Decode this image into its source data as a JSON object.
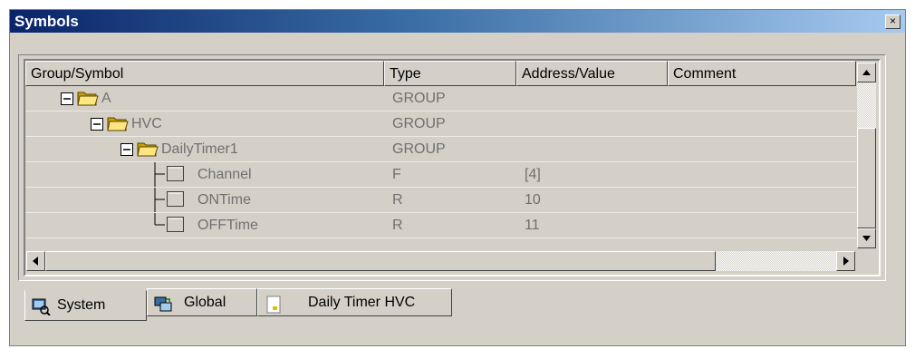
{
  "window": {
    "title": "Symbols",
    "close_glyph": "×"
  },
  "columns": [
    "Group/Symbol",
    "Type",
    "Address/Value",
    "Comment"
  ],
  "rows": [
    {
      "name": "A",
      "type": "GROUP",
      "value": "",
      "comment": "",
      "icon": "folder-open-icon",
      "expander": "minus"
    },
    {
      "name": "HVC",
      "type": "GROUP",
      "value": "",
      "comment": "",
      "icon": "folder-open-icon",
      "expander": "minus"
    },
    {
      "name": "DailyTimer1",
      "type": "GROUP",
      "value": "",
      "comment": "",
      "icon": "folder-open-icon",
      "expander": "minus"
    },
    {
      "name": "Channel",
      "type": "F",
      "value": "[4]",
      "comment": "",
      "icon": "symbol-box-icon",
      "connector": "tee"
    },
    {
      "name": "ONTime",
      "type": "R",
      "value": "10",
      "comment": "",
      "icon": "symbol-box-icon",
      "connector": "tee"
    },
    {
      "name": "OFFTime",
      "type": "R",
      "value": "11",
      "comment": "",
      "icon": "symbol-box-icon",
      "connector": "end"
    }
  ],
  "tabs": [
    {
      "label": "System",
      "icon": "system-tab-icon",
      "active": true
    },
    {
      "label": "Global",
      "icon": "global-tab-icon",
      "active": false
    },
    {
      "label": "Daily Timer HVC",
      "icon": "document-tab-icon",
      "active": false
    }
  ],
  "colors": {
    "title_start": "#0a246a",
    "title_end": "#a6caf0",
    "face": "#d4d0c8",
    "cell_text": "#707070"
  }
}
